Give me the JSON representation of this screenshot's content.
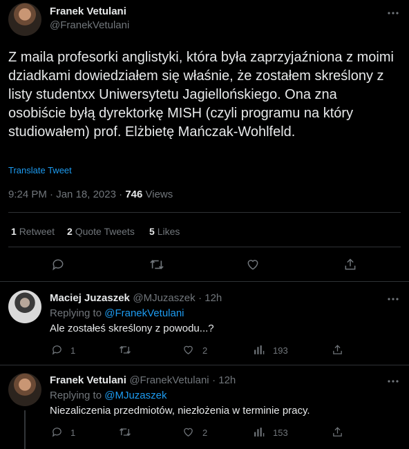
{
  "tweet": {
    "author_name": "Franek Vetulani",
    "author_handle": "@FranekVetulani",
    "text": "Z maila profesorki anglistyki, która była zaprzyjaźniona z moimi dziadkami dowiedziałem się właśnie, że zostałem skreślony z listy studentxx Uniwersytetu Jagiellońskiego. Ona zna osobiście byłą dyrektorkę MISH (czyli programu na który studiowałem) prof. Elżbietę Mańczak-Wohlfeld.",
    "translate_label": "Translate Tweet",
    "time": "9:24 PM",
    "date": "Jan 18, 2023",
    "views_count": "746",
    "views_label": "Views",
    "retweets_count": "1",
    "retweets_label": "Retweet",
    "quotes_count": "2",
    "quotes_label": "Quote Tweets",
    "likes_count": "5",
    "likes_label": "Likes"
  },
  "replies": [
    {
      "author_name": "Maciej Juzaszek",
      "author_handle": "@MJuzaszek",
      "age": "12h",
      "replying_to_label": "Replying to",
      "replying_to": "@FranekVetulani",
      "text": "Ale zostałeś skreślony z powodu...?",
      "reply_count": "1",
      "retweet_count": "",
      "like_count": "2",
      "view_count": "193"
    },
    {
      "author_name": "Franek Vetulani",
      "author_handle": "@FranekVetulani",
      "age": "12h",
      "replying_to_label": "Replying to",
      "replying_to": "@MJuzaszek",
      "text": "Niezaliczenia przedmiotów, niezłożenia w terminie pracy.",
      "reply_count": "1",
      "retweet_count": "",
      "like_count": "2",
      "view_count": "153"
    }
  ],
  "icons": {
    "more": "more-icon",
    "reply": "reply-icon",
    "retweet": "retweet-icon",
    "like": "heart-icon",
    "share": "share-icon",
    "views": "views-icon"
  },
  "colors": {
    "background": "#000000",
    "text": "#e7e9ea",
    "muted": "#71767b",
    "accent": "#1d9bf0",
    "divider": "#2f3336"
  }
}
